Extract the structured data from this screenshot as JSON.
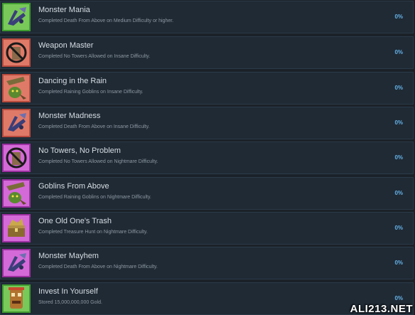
{
  "achievements": [
    {
      "title": "Monster Mania",
      "description": "Completed Death From Above on Medium Difficulty or higher.",
      "percent": "0%",
      "icon": "green-monster-icon"
    },
    {
      "title": "Weapon Master",
      "description": "Completed No Towers Allowed on Insane Difficulty.",
      "percent": "0%",
      "icon": "red-no-towers-icon"
    },
    {
      "title": "Dancing in the Rain",
      "description": "Completed Raining Goblins on Insane Difficulty.",
      "percent": "0%",
      "icon": "red-goblin-icon"
    },
    {
      "title": "Monster Madness",
      "description": "Completed Death From Above on Insane Difficulty.",
      "percent": "0%",
      "icon": "red-monster-icon"
    },
    {
      "title": "No Towers, No Problem",
      "description": "Completed No Towers Allowed on Nightmare Difficulty.",
      "percent": "0%",
      "icon": "purple-no-towers-icon"
    },
    {
      "title": "Goblins From Above",
      "description": "Completed Raining Goblins on Nightmare Difficulty.",
      "percent": "0%",
      "icon": "purple-goblin-icon"
    },
    {
      "title": "One Old One's Trash",
      "description": "Completed Treasure Hunt on Nightmare Difficulty.",
      "percent": "0%",
      "icon": "purple-treasure-icon"
    },
    {
      "title": "Monster Mayhem",
      "description": "Completed Death From Above on Nightmare Difficulty.",
      "percent": "0%",
      "icon": "purple-monster-icon"
    },
    {
      "title": "Invest In Yourself",
      "description": "Stored 15,000,000,000 Gold.",
      "percent": "0%",
      "icon": "green-totem-icon"
    }
  ],
  "watermark": "ALI213.NET",
  "colors": {
    "row_bg": "#1f2a35",
    "row_border": "#2b3a48",
    "title": "#d8dde2",
    "description": "#8d98a3",
    "percent": "#66b3e8",
    "icon_green": "#4fae3a",
    "icon_red": "#c9584a",
    "icon_purple": "#b93fbf"
  }
}
